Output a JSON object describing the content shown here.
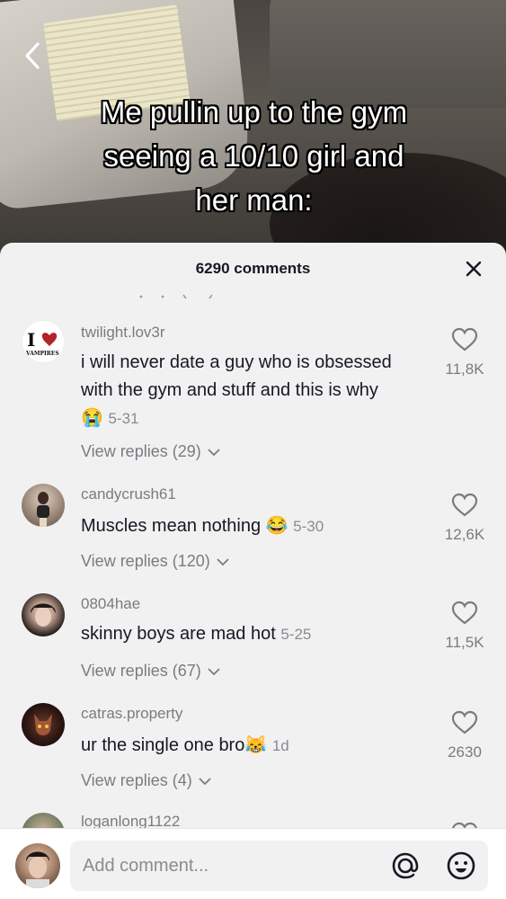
{
  "video": {
    "overlay_lines": [
      "Me pullin up to the gym",
      "seeing a 10/10 girl and",
      "her man:"
    ]
  },
  "sheet": {
    "title": "6290 comments"
  },
  "comments": [
    {
      "username": "twilight.lov3r",
      "text_lines": [
        "i will never date a guy who is obsessed",
        "with the gym and stuff and this is why"
      ],
      "emoji": "😭",
      "date": "5-31",
      "likes": "11,8K",
      "replies": "View replies (29)",
      "avatar_text_top": "I",
      "avatar_text_bottom": "VAMPIRES"
    },
    {
      "username": "candycrush61",
      "text": "Muscles mean nothing",
      "emoji": "😂",
      "date": "5-30",
      "likes": "12,6K",
      "replies": "View replies (120)"
    },
    {
      "username": "0804hae",
      "text": "skinny boys are mad hot",
      "date": "5-25",
      "likes": "11,5K",
      "replies": "View replies (67)"
    },
    {
      "username": "catras.property",
      "text": "ur the single one bro",
      "emoji": "😹",
      "date": "1d",
      "likes": "2630",
      "replies": "View replies (4)"
    },
    {
      "username": "loganlong1122"
    }
  ],
  "input": {
    "placeholder": "Add comment..."
  },
  "colors": {
    "sheet_bg": "#f1f1f2",
    "text_primary": "#161823",
    "text_secondary": "#7a7b80",
    "heart_red": "#c8262b"
  },
  "icons": [
    "back-icon",
    "close-icon",
    "heart-icon",
    "chevron-down-icon",
    "at-icon",
    "emoji-icon"
  ]
}
